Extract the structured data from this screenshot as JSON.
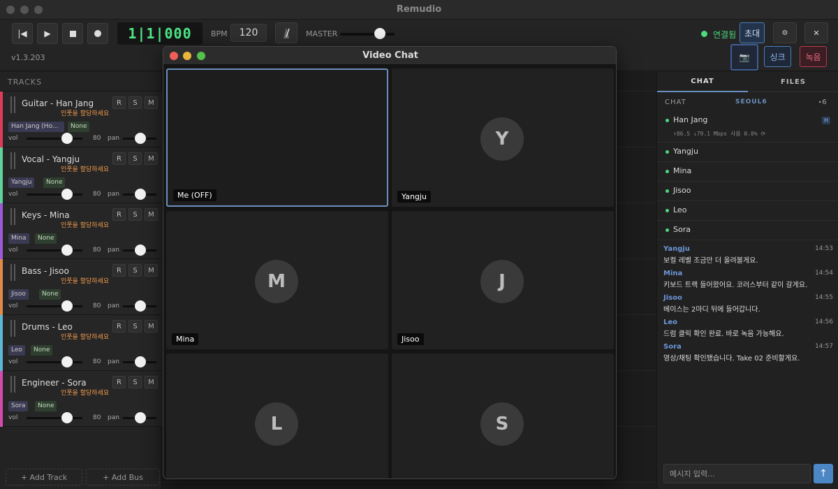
{
  "app": {
    "title": "Remudio",
    "version": "v1.3.203"
  },
  "transport": {
    "time": "1|1|000",
    "bpm_label": "BPM",
    "bpm": "120",
    "master_label": "MASTER"
  },
  "header": {
    "status": "연결됨",
    "invite": "초대",
    "sync": "싱크",
    "record": "녹음",
    "settings_icon": "gear-icon",
    "close_icon": "close-icon",
    "video_icon": "camera-icon"
  },
  "tracks": {
    "header": "TRACKS",
    "assign_hint": "인풋을 할당하세요",
    "r": "R",
    "s": "S",
    "m": "M",
    "vol_label": "vol",
    "pan_label": "pan",
    "none": "None",
    "items": [
      {
        "name": "Guitar - Han Jang",
        "user": "Han Jang (Ho...",
        "vol": "80",
        "color": "#e03a5a"
      },
      {
        "name": "Vocal - Yangju",
        "user": "Yangju",
        "vol": "80",
        "color": "#5ed39a"
      },
      {
        "name": "Keys - Mina",
        "user": "Mina",
        "vol": "80",
        "color": "#9b59d6"
      },
      {
        "name": "Bass - Jisoo",
        "user": "Jisoo",
        "vol": "80",
        "color": "#e08a4a"
      },
      {
        "name": "Drums - Leo",
        "user": "Leo",
        "vol": "80",
        "color": "#5bb8d6"
      },
      {
        "name": "Engineer - Sora",
        "user": "Sora",
        "vol": "80",
        "color": "#d64ab0"
      }
    ],
    "add_track": "+ Add Track",
    "add_bus": "+ Add Bus"
  },
  "video": {
    "title": "Video Chat",
    "tiles": [
      {
        "name": "Me (OFF)",
        "initial": ""
      },
      {
        "name": "Yangju",
        "initial": "Y"
      },
      {
        "name": "Mina",
        "initial": "M"
      },
      {
        "name": "Jisoo",
        "initial": "J"
      },
      {
        "name": "",
        "initial": "L"
      },
      {
        "name": "",
        "initial": "S"
      }
    ]
  },
  "chat": {
    "tab_chat": "CHAT",
    "tab_files": "FILES",
    "section_label": "CHAT",
    "room": "SEOUL6",
    "count": "⋆6",
    "host_badge": "H",
    "host_stats": "↑86.5 ↓79.1 Mbps 사용 0.0% ⟳",
    "users": [
      "Han Jang",
      "Yangju",
      "Mina",
      "Jisoo",
      "Leo",
      "Sora"
    ],
    "messages": [
      {
        "name": "Yangju",
        "time": "14:53",
        "text": "보컬 레벨 조금만 더 올려볼게요."
      },
      {
        "name": "Mina",
        "time": "14:54",
        "text": "키보드 트랙 들어왔어요. 코러스부터 같이 갈게요."
      },
      {
        "name": "Jisoo",
        "time": "14:55",
        "text": "베이스는 2마디 뒤에 들어갑니다."
      },
      {
        "name": "Leo",
        "time": "14:56",
        "text": "드럼 클릭 확인 완료. 바로 녹음 가능해요."
      },
      {
        "name": "Sora",
        "time": "14:57",
        "text": "영상/채팅 확인됐습니다. Take 02 준비할게요."
      }
    ],
    "input_placeholder": "메시지 입력...",
    "send_icon": "arrow-up-icon"
  }
}
